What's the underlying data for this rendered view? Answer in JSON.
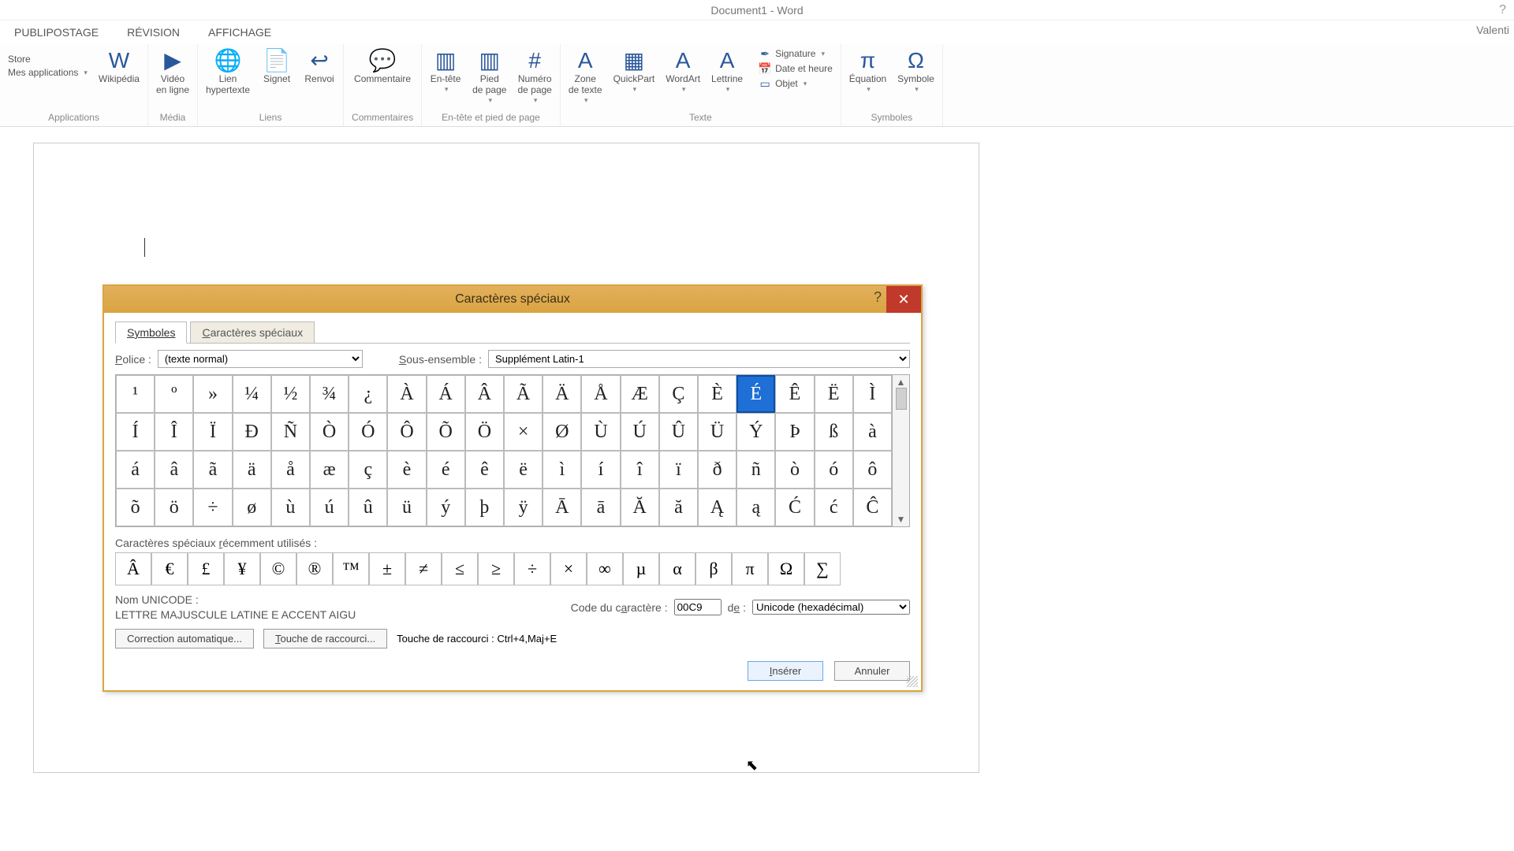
{
  "window": {
    "title": "Document1 - Word",
    "help_icon": "?",
    "user": "Valenti"
  },
  "ribbon_tabs": [
    "PUBLIPOSTAGE",
    "RÉVISION",
    "AFFICHAGE"
  ],
  "ribbon": {
    "groups": [
      {
        "name": "Applications",
        "items": [
          {
            "label": "Store",
            "icon": "",
            "stacked": true
          },
          {
            "label": "Mes applications",
            "icon": "",
            "stacked": true,
            "dropdown": true
          },
          {
            "label": "Wikipédia",
            "icon": "W"
          }
        ]
      },
      {
        "name": "Média",
        "items": [
          {
            "label": "Vidéo en ligne",
            "icon": "▶"
          }
        ]
      },
      {
        "name": "Liens",
        "items": [
          {
            "label": "Lien hypertexte",
            "icon": "🌐"
          },
          {
            "label": "Signet",
            "icon": "📄"
          },
          {
            "label": "Renvoi",
            "icon": "↩"
          }
        ]
      },
      {
        "name": "Commentaires",
        "items": [
          {
            "label": "Commentaire",
            "icon": "💬"
          }
        ]
      },
      {
        "name": "En-tête et pied de page",
        "items": [
          {
            "label": "En-tête",
            "icon": "▥",
            "dropdown": true
          },
          {
            "label": "Pied de page",
            "icon": "▥",
            "dropdown": true
          },
          {
            "label": "Numéro de page",
            "icon": "#",
            "dropdown": true
          }
        ]
      },
      {
        "name": "Texte",
        "items": [
          {
            "label": "Zone de texte",
            "icon": "A",
            "dropdown": true
          },
          {
            "label": "QuickPart",
            "icon": "▦",
            "dropdown": true
          },
          {
            "label": "WordArt",
            "icon": "A",
            "dropdown": true
          },
          {
            "label": "Lettrine",
            "icon": "A",
            "dropdown": true
          }
        ],
        "mini": [
          {
            "label": "Signature",
            "icon": "✒",
            "dropdown": true
          },
          {
            "label": "Date et heure",
            "icon": "📅"
          },
          {
            "label": "Objet",
            "icon": "▭",
            "dropdown": true
          }
        ]
      },
      {
        "name": "Symboles",
        "items": [
          {
            "label": "Équation",
            "icon": "π",
            "dropdown": true
          },
          {
            "label": "Symbole",
            "icon": "Ω",
            "dropdown": true
          }
        ]
      }
    ]
  },
  "dialog": {
    "title": "Caractères spéciaux",
    "help_icon": "?",
    "close_icon": "✕",
    "tabs": {
      "symbols": "Symboles",
      "specials_mnemonic_pre": "C",
      "specials_rest": "aractères spéciaux"
    },
    "font_label_pre": "P",
    "font_label_rest": "olice :",
    "font_value": "(texte normal)",
    "subset_label_pre": "S",
    "subset_label_rest": "ous-ensemble :",
    "subset_value": "Supplément Latin-1",
    "grid": [
      [
        "¹",
        "º",
        "»",
        "¼",
        "½",
        "¾",
        "¿",
        "À",
        "Á",
        "Â",
        "Ã",
        "Ä",
        "Å",
        "Æ",
        "Ç",
        "È",
        "É",
        "Ê",
        "Ë",
        "Ì"
      ],
      [
        "Í",
        "Î",
        "Ï",
        "Đ",
        "Ñ",
        "Ò",
        "Ó",
        "Ô",
        "Õ",
        "Ö",
        "×",
        "Ø",
        "Ù",
        "Ú",
        "Û",
        "Ü",
        "Ý",
        "Þ",
        "ß",
        "à"
      ],
      [
        "á",
        "â",
        "ã",
        "ä",
        "å",
        "æ",
        "ç",
        "è",
        "é",
        "ê",
        "ë",
        "ì",
        "í",
        "î",
        "ï",
        "ð",
        "ñ",
        "ò",
        "ó",
        "ô"
      ],
      [
        "õ",
        "ö",
        "÷",
        "ø",
        "ù",
        "ú",
        "û",
        "ü",
        "ý",
        "þ",
        "ÿ",
        "Ā",
        "ā",
        "Ă",
        "ă",
        "Ą",
        "ą",
        "Ć",
        "ć",
        "Ĉ"
      ]
    ],
    "selected_char": "É",
    "recent_label_pre": "Caractères spéciaux ",
    "recent_label_mnemonic": "r",
    "recent_label_rest": "écemment utilisés :",
    "recent": [
      "Â",
      "€",
      "£",
      "¥",
      "©",
      "®",
      "™",
      "±",
      "≠",
      "≤",
      "≥",
      "÷",
      "×",
      "∞",
      "µ",
      "α",
      "β",
      "π",
      "Ω",
      "∑"
    ],
    "unicode_name_label": "Nom UNICODE :",
    "unicode_name": "LETTRE MAJUSCULE LATINE E ACCENT AIGU",
    "code_label_pre": "Code du c",
    "code_label_mnemonic": "a",
    "code_label_rest": "ractère :",
    "code_value": "00C9",
    "from_label_pre": "d",
    "from_label_mnemonic": "e",
    "from_label_rest": " :",
    "from_value": "Unicode (hexadécimal)",
    "autocorrect_btn": "Correction automatique...",
    "shortcut_btn_pre": "T",
    "shortcut_btn_rest": "ouche de raccourci...",
    "shortcut_label": "Touche de raccourci : Ctrl+4,Maj+E",
    "insert_btn_pre": "I",
    "insert_btn_rest": "nsérer",
    "cancel_btn": "Annuler"
  }
}
